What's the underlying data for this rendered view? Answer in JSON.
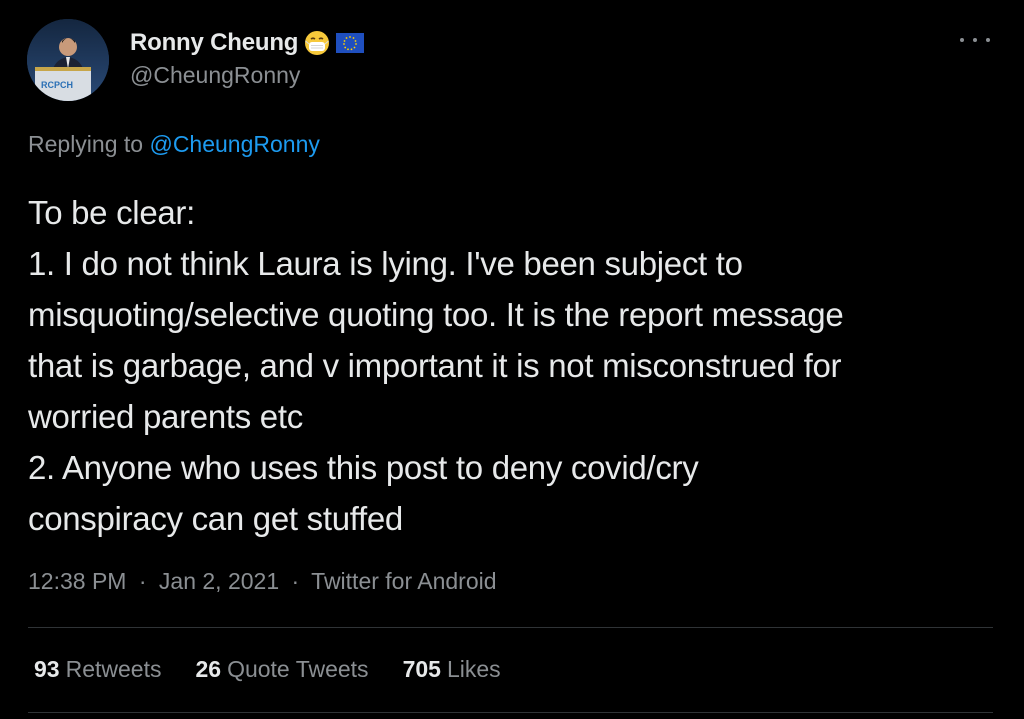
{
  "author": {
    "display_name": "Ronny Cheung",
    "handle": "@CheungRonny",
    "avatar_logo_text": "RCPCH",
    "badges": [
      "mask-emoji-icon",
      "eu-flag-icon"
    ]
  },
  "reply": {
    "prefix": "Replying to",
    "mention": "@CheungRonny"
  },
  "tweet": {
    "lines": [
      "To be clear:",
      "1. I do not think Laura is lying. I've been subject to",
      "misquoting/selective quoting too. It is the report message",
      "that is garbage, and v important it is not misconstrued for",
      "worried parents etc",
      "2. Anyone who uses this post to deny covid/cry",
      "conspiracy can get stuffed"
    ]
  },
  "meta": {
    "time": "12:38 PM",
    "date": "Jan 2, 2021",
    "source": "Twitter for Android",
    "separator": "·"
  },
  "stats": {
    "retweets_count": "93",
    "retweets_label": "Retweets",
    "quotes_count": "26",
    "quotes_label": "Quote Tweets",
    "likes_count": "705",
    "likes_label": "Likes"
  },
  "colors": {
    "background": "#000000",
    "accent": "#1d9bf0",
    "text_primary": "#e7e9ea",
    "text_secondary": "#8b8f93"
  }
}
